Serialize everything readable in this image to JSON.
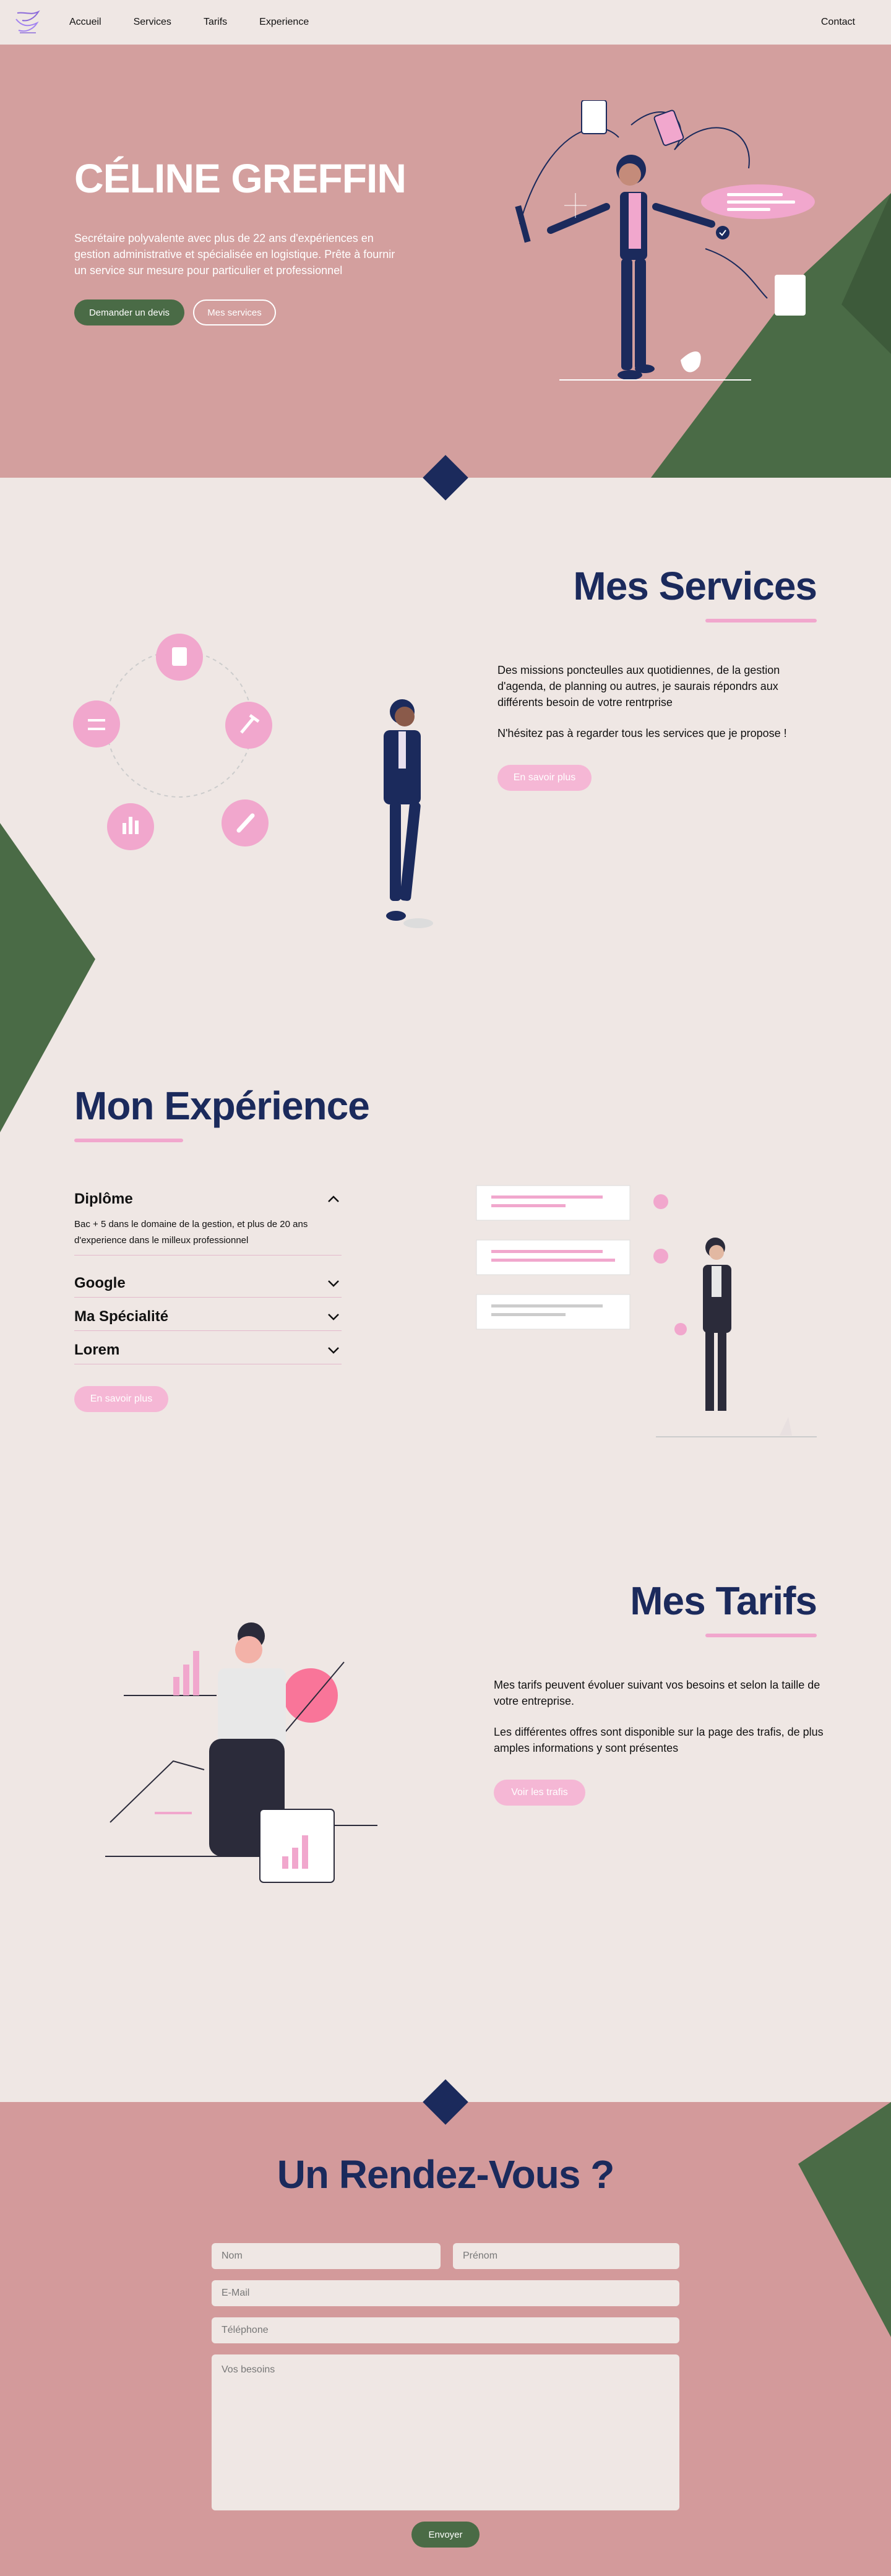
{
  "nav": {
    "links": [
      "Accueil",
      "Services",
      "Tarifs",
      "Experience"
    ],
    "contact": "Contact"
  },
  "hero": {
    "title": "CÉLINE GREFFIN",
    "text": "Secrétaire polyvalente avec plus de 22 ans d'expériences en gestion administrative et spécialisée en logistique. Prête à fournir un service sur mesure pour particulier et professionnel",
    "quote_button": "Demander un devis",
    "services_button": "Mes services"
  },
  "services": {
    "title": "Mes Services",
    "paragraph1": "Des missions poncteulles aux quotidiennes, de la gestion d'agenda, de planning ou autres, je saurais répondrs aux différents besoin de votre rentrprise",
    "paragraph2": "N'hésitez pas à regarder tous les services que je propose !",
    "button": "En savoir plus"
  },
  "experience": {
    "title": "Mon Expérience",
    "items": [
      {
        "title": "Diplôme",
        "body": "Bac + 5 dans le domaine de la gestion, et plus de 20 ans d'experience dans le milleux professionnel",
        "open": true
      },
      {
        "title": "Google",
        "body": "",
        "open": false
      },
      {
        "title": "Ma Spécialité",
        "body": "",
        "open": false
      },
      {
        "title": "Lorem",
        "body": "",
        "open": false
      }
    ],
    "button": "En savoir plus"
  },
  "tarifs": {
    "title": "Mes Tarifs",
    "paragraph1": "Mes tarifs peuvent évoluer suivant vos besoins et selon la taille de votre entreprise.",
    "paragraph2": "Les différentes offres sont disponible sur la page des trafis, de plus amples informations y sont présentes",
    "button": "Voir les trafis"
  },
  "rdv": {
    "title": "Un Rendez-Vous ?",
    "placeholders": {
      "nom": "Nom",
      "prenom": "Prénom",
      "email": "E-Mail",
      "telephone": "Téléphone",
      "besoins": "Vos besoins"
    },
    "submit": "Envoyer"
  },
  "colors": {
    "background": "#efe7e4",
    "hero_pink": "#d39f9e",
    "green": "#4a6b46",
    "navy": "#1b2a5c",
    "accent_pink": "#f1a7cd"
  }
}
